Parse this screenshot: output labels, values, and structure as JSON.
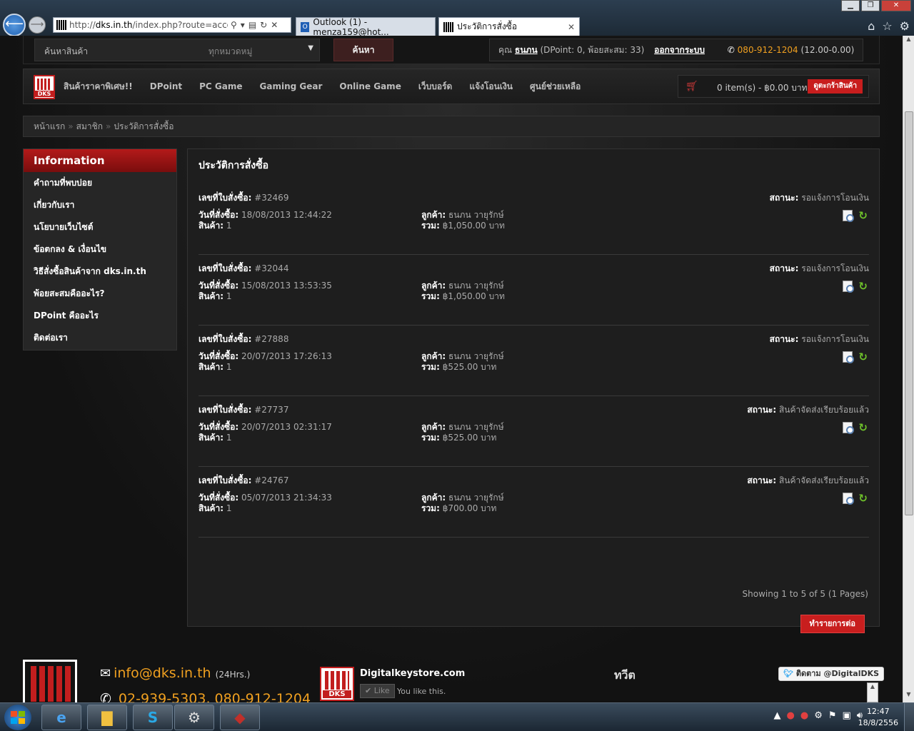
{
  "browser": {
    "url_prefix": "http://",
    "url_host": "dks.in.th",
    "url_path": "/index.php?route=account/",
    "tabs": [
      {
        "label": "Outlook (1) - menza159@hot..."
      },
      {
        "label": "ประวัติการสั่งซื้อ",
        "close": "✕"
      }
    ]
  },
  "topbar": {
    "search_placeholder": "ค้นหาสินค้า",
    "category": "ทุกหมวดหมู่",
    "search_button": "ค้นหา",
    "account_prefix": "คุณ",
    "username": "ธนภน",
    "points": "(DPoint: 0, พ้อยสะสม: 33)",
    "logout": "ออกจากระบบ",
    "phone": "080-912-1204",
    "hours": "(12.00-0.00)"
  },
  "nav": {
    "logo_text": "DKS",
    "items": [
      "สินค้าราคาพิเศษ!!",
      "DPoint",
      "PC Game",
      "Gaming Gear",
      "Online Game",
      "เว็บบอร์ด",
      "แจ้งโอนเงิน",
      "ศูนย์ช่วยเหลือ"
    ],
    "cart_summary": "0 item(s) - ฿0.00 บาท",
    "cart_button": "ดูตะกร้าสินค้า"
  },
  "breadcrumb": [
    "หน้าแรก",
    "สมาชิก",
    "ประวัติการสั่งซื้อ"
  ],
  "sidebar": {
    "heading": "Information",
    "items": [
      "คำถามที่พบบ่อย",
      "เกี่ยวกับเรา",
      "นโยบายเว็บไซต์",
      "ข้อตกลง & เงื่อนไข",
      "วิธีสั่งซื้อสินค้าจาก dks.in.th",
      "พ้อยสะสมคืออะไร?",
      "DPoint คืออะไร",
      "ติดต่อเรา"
    ]
  },
  "orders_labels": {
    "order_id": "เลขที่ใบสั่งซื้อ:",
    "date": "วันที่สั่งซื้อ:",
    "products": "สินค้า:",
    "customer": "ลูกค้า:",
    "total": "รวม:",
    "status": "สถานะ:"
  },
  "content": {
    "title": "ประวัติการสั่งซื้อ",
    "orders": [
      {
        "id": "#32469",
        "date": "18/08/2013 12:44:22",
        "products": "1",
        "customer": "ธนภน วายุรักษ์",
        "total": "฿1,050.00 บาท",
        "status": "รอแจ้งการโอนเงิน"
      },
      {
        "id": "#32044",
        "date": "15/08/2013 13:53:35",
        "products": "1",
        "customer": "ธนภน วายุรักษ์",
        "total": "฿1,050.00 บาท",
        "status": "รอแจ้งการโอนเงิน"
      },
      {
        "id": "#27888",
        "date": "20/07/2013 17:26:13",
        "products": "1",
        "customer": "ธนภน วายุรักษ์",
        "total": "฿525.00 บาท",
        "status": "รอแจ้งการโอนเงิน"
      },
      {
        "id": "#27737",
        "date": "20/07/2013 02:31:17",
        "products": "1",
        "customer": "ธนภน วายุรักษ์",
        "total": "฿525.00 บาท",
        "status": "สินค้าจัดส่งเรียบร้อยแล้ว"
      },
      {
        "id": "#24767",
        "date": "05/07/2013 21:34:33",
        "products": "1",
        "customer": "ธนภน วายุรักษ์",
        "total": "฿700.00 บาท",
        "status": "สินค้าจัดส่งเรียบร้อยแล้ว"
      }
    ],
    "showing": "Showing 1 to 5 of 5 (1 Pages)",
    "continue_button": "ทำรายการต่อ"
  },
  "footer": {
    "email": "info@dks.in.th",
    "email_hours": "(24Hrs.)",
    "phones": "02-939-5303, 080-912-1204",
    "fb_name": "Digitalkeystore.com",
    "fb_like": "Like",
    "fb_you_like": "You like this.",
    "tweet_heading": "ทวีต",
    "follow": "ติดตาม @DigitalDKS"
  },
  "taskbar": {
    "time": "12:47",
    "date": "18/8/2556"
  },
  "colors": {
    "accent_red": "#c81e1e",
    "phone_orange": "#f0a020"
  }
}
